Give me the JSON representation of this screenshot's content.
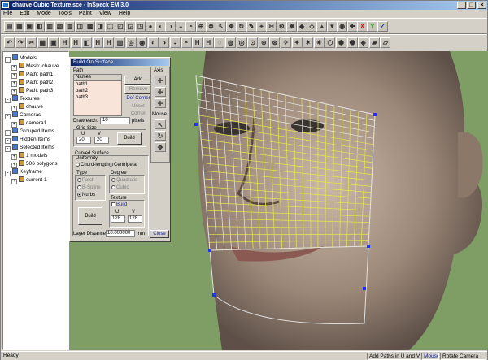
{
  "app": {
    "title": "chauve Cubic Texture.sce - InSpeck EM 3.0"
  },
  "menu": [
    "File",
    "Edit",
    "Mode",
    "Tools",
    "Paint",
    "View",
    "Help"
  ],
  "tree": [
    {
      "label": "Models",
      "indent": 0,
      "icon": "models-icon"
    },
    {
      "label": "Mesh: chauve",
      "indent": 1,
      "icon": "mesh-icon"
    },
    {
      "label": "Path: path1",
      "indent": 1,
      "icon": "path-icon"
    },
    {
      "label": "Path: path2",
      "indent": 1,
      "icon": "path-icon"
    },
    {
      "label": "Path: path3",
      "indent": 1,
      "icon": "path-icon"
    },
    {
      "label": "Textures",
      "indent": 0,
      "icon": "textures-icon"
    },
    {
      "label": "chauve",
      "indent": 1,
      "icon": "texture-icon"
    },
    {
      "label": "Cameras",
      "indent": 0,
      "icon": "cameras-icon"
    },
    {
      "label": "camera1",
      "indent": 1,
      "icon": "camera-icon"
    },
    {
      "label": "Grouped Items",
      "indent": 0,
      "icon": "group-icon"
    },
    {
      "label": "Hidden Items",
      "indent": 0,
      "icon": "hidden-icon"
    },
    {
      "label": "Selected Items",
      "indent": 0,
      "icon": "selected-icon"
    },
    {
      "label": "1 models",
      "indent": 1,
      "icon": "model-count-icon"
    },
    {
      "label": "506 polygons",
      "indent": 1,
      "icon": "polygon-count-icon"
    },
    {
      "label": "Keyframe",
      "indent": 0,
      "icon": "keyframe-icon"
    },
    {
      "label": "current 1",
      "indent": 1,
      "icon": "frame-icon"
    }
  ],
  "dialog": {
    "title": "Build On Surface",
    "path_group": "Path",
    "names_header": "Names",
    "paths": [
      "path1",
      "path2",
      "path3"
    ],
    "add_label": "Add",
    "remove_label": "Remove",
    "def_corner_label": "Def Corner",
    "unset_corner_label": "Unset Corner",
    "draw_each_label": "Draw each:",
    "draw_each_value": "10",
    "draw_each_unit": "pixels",
    "grid_size_label": "Grid Size",
    "grid_u_label": "U",
    "grid_v_label": "V",
    "grid_u": "20",
    "grid_v": "20",
    "build_grid_label": "Build",
    "curved_surface_label": "Curved Surface",
    "uniformity_label": "Uniformity",
    "chord_length": "Chord-length",
    "centripetal": "Centripetal",
    "type_label": "Type",
    "type_options": [
      "Patch",
      "B-Spline",
      "Nurbs"
    ],
    "degree_label": "Degree",
    "degree_options": [
      "Quadratic",
      "Cubic"
    ],
    "texture_label": "Texture",
    "texture_build": "Build",
    "tex_u_label": "U",
    "tex_v_label": "V",
    "tex_u": "128",
    "tex_v": "128",
    "build_surface_label": "Build",
    "layer_distance_label": "Layer Distance:",
    "layer_distance_value": "10.000000",
    "layer_distance_unit": "mm",
    "close_label": "Close"
  },
  "axis_panel": {
    "axis_label": "Axis",
    "mouse_label": "Mouse"
  },
  "status": {
    "ready": "Ready",
    "hint": "Add Paths in U and V",
    "mouse": "Mouse",
    "mode": "Rotate Camera"
  },
  "colors": {
    "title_start": "#0a246a",
    "title_end": "#a6caf0",
    "viewport_bg": "#7e9e66",
    "grid": "#e8e84a",
    "accent": "#2a7ad8"
  }
}
